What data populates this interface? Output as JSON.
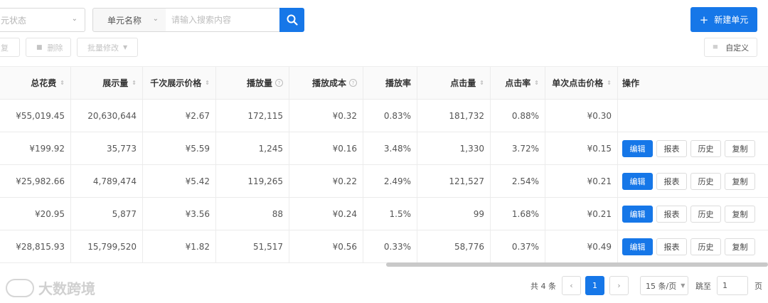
{
  "filters": {
    "status_placeholder": "元状态",
    "name_select": "单元名称",
    "search_placeholder": "请输入搜索内容"
  },
  "toolbar": {
    "new_unit": "新建单元",
    "duplicate": "复",
    "delete": "删除",
    "batch_edit": "批量修改",
    "customize": "自定义"
  },
  "table": {
    "headers": [
      "总花费",
      "展示量",
      "千次展示价格",
      "播放量",
      "播放成本",
      "播放率",
      "点击量",
      "点击率",
      "单次点击价格",
      "操作"
    ],
    "rows": [
      [
        "¥55,019.45",
        "20,630,644",
        "¥2.67",
        "172,115",
        "¥0.32",
        "0.83%",
        "181,732",
        "0.88%",
        "¥0.30"
      ],
      [
        "¥199.92",
        "35,773",
        "¥5.59",
        "1,245",
        "¥0.16",
        "3.48%",
        "1,330",
        "3.72%",
        "¥0.15"
      ],
      [
        "¥25,982.66",
        "4,789,474",
        "¥5.42",
        "119,265",
        "¥0.22",
        "2.49%",
        "121,527",
        "2.54%",
        "¥0.21"
      ],
      [
        "¥20.95",
        "5,877",
        "¥3.56",
        "88",
        "¥0.24",
        "1.5%",
        "99",
        "1.68%",
        "¥0.21"
      ],
      [
        "¥28,815.93",
        "15,799,520",
        "¥1.82",
        "51,517",
        "¥0.56",
        "0.33%",
        "58,776",
        "0.37%",
        "¥0.49"
      ]
    ],
    "actions": [
      "编辑",
      "报表",
      "历史",
      "复制"
    ]
  },
  "pagination": {
    "total": "共 4 条",
    "current_page": "1",
    "page_size": "15 条/页",
    "jump_label": "跳至",
    "jump_value": "1",
    "page_unit": "页"
  },
  "watermark": "大数跨境",
  "colors": {
    "primary": "#1677e8"
  }
}
